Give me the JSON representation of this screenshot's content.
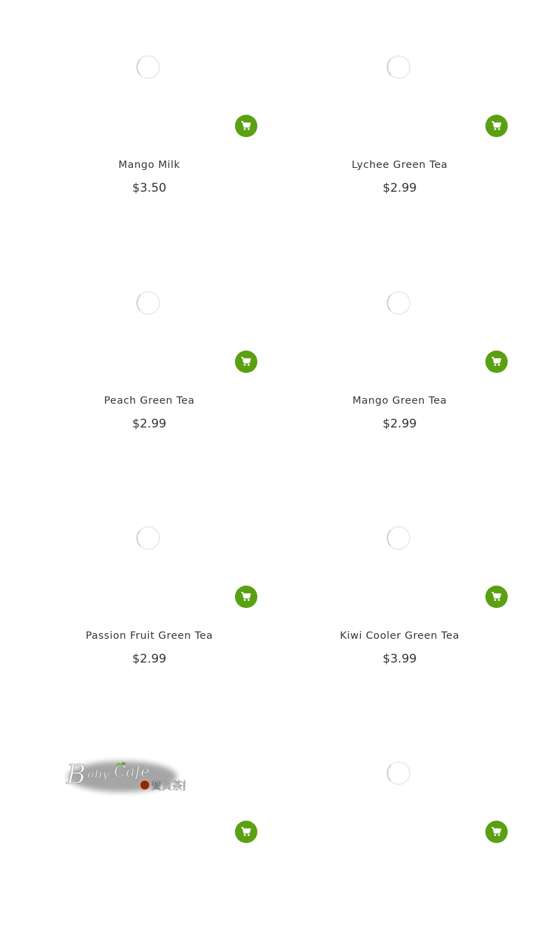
{
  "products": [
    {
      "name": "Mango Milk",
      "price": "$3.50"
    },
    {
      "name": "Lychee Green Tea",
      "price": "$2.99"
    },
    {
      "name": "Peach Green Tea",
      "price": "$2.99"
    },
    {
      "name": "Mango Green Tea",
      "price": "$2.99"
    },
    {
      "name": "Passion Fruit Green Tea",
      "price": "$2.99"
    },
    {
      "name": "Kiwi Cooler Green Tea",
      "price": "$3.99"
    },
    {
      "name": "",
      "price": ""
    },
    {
      "name": "",
      "price": ""
    }
  ],
  "icons": {
    "cart_button": "shopping-cart-icon",
    "loading": "loading-spinner-icon"
  },
  "colors": {
    "accent": "#5aa012",
    "text": "#333333",
    "background": "#ffffff"
  },
  "logo": {
    "text": "Baby Cafe 寶貝茶記"
  }
}
